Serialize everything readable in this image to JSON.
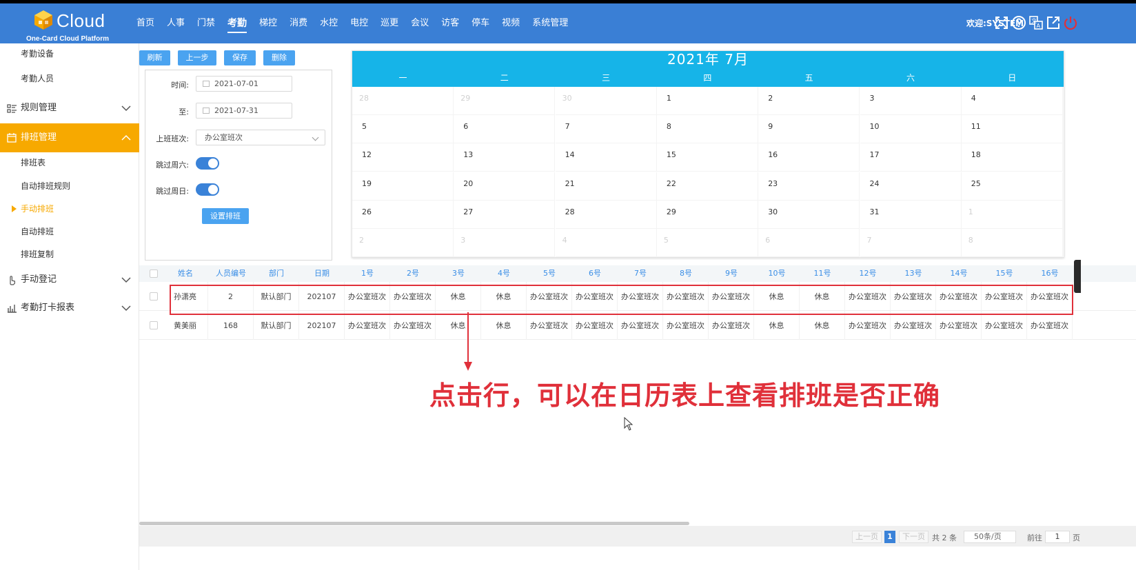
{
  "header": {
    "logo_word": "Cloud",
    "logo_sub": "One-Card Cloud Platform",
    "nav": [
      "首页",
      "人事",
      "门禁",
      "考勤",
      "梯控",
      "消费",
      "水控",
      "电控",
      "巡更",
      "会议",
      "访客",
      "停车",
      "视频",
      "系统管理"
    ],
    "active_nav": "考勤",
    "welcome": "欢迎:SYSTEM",
    "icons": [
      "fullscreen-icon",
      "help-icon",
      "translate-icon",
      "external-link-icon",
      "power-icon"
    ]
  },
  "sidebar": {
    "items": [
      {
        "label": "考勤设备",
        "type": "sub"
      },
      {
        "label": "考勤人员",
        "type": "sub"
      },
      {
        "label": "规则管理",
        "type": "group",
        "icon": "rules-list-icon"
      },
      {
        "label": "排班管理",
        "type": "group-active",
        "icon": "calendar-schedule-icon"
      },
      {
        "label": "排班表",
        "type": "sub"
      },
      {
        "label": "自动排班规则",
        "type": "sub"
      },
      {
        "label": "手动排班",
        "type": "current"
      },
      {
        "label": "自动排班",
        "type": "sub"
      },
      {
        "label": "排班复制",
        "type": "sub"
      },
      {
        "label": "手动登记",
        "type": "group",
        "icon": "hand-pointer-icon"
      },
      {
        "label": "考勤打卡报表",
        "type": "group",
        "icon": "bar-chart-icon"
      }
    ]
  },
  "toolbar": {
    "refresh": "刷新",
    "prev": "上一步",
    "save": "保存",
    "delete": "删除"
  },
  "form": {
    "time_label": "时间:",
    "time_value": "2021-07-01",
    "to_label": "至:",
    "to_value": "2021-07-31",
    "shift_label": "上班班次:",
    "shift_value": "办公室班次",
    "skip_sat_label": "跳过周六:",
    "skip_sat": true,
    "skip_sun_label": "跳过周日:",
    "skip_sun": true,
    "set_button": "设置排班"
  },
  "calendar": {
    "title": "2021年  7月",
    "weekdays": [
      "一",
      "二",
      "三",
      "四",
      "五",
      "六",
      "日"
    ],
    "weeks": [
      [
        {
          "d": "28",
          "o": true
        },
        {
          "d": "29",
          "o": true
        },
        {
          "d": "30",
          "o": true
        },
        {
          "d": "1"
        },
        {
          "d": "2"
        },
        {
          "d": "3"
        },
        {
          "d": "4"
        }
      ],
      [
        {
          "d": "5"
        },
        {
          "d": "6"
        },
        {
          "d": "7"
        },
        {
          "d": "8"
        },
        {
          "d": "9"
        },
        {
          "d": "10"
        },
        {
          "d": "11"
        }
      ],
      [
        {
          "d": "12"
        },
        {
          "d": "13"
        },
        {
          "d": "14"
        },
        {
          "d": "15"
        },
        {
          "d": "16"
        },
        {
          "d": "17"
        },
        {
          "d": "18"
        }
      ],
      [
        {
          "d": "19"
        },
        {
          "d": "20"
        },
        {
          "d": "21"
        },
        {
          "d": "22"
        },
        {
          "d": "23"
        },
        {
          "d": "24"
        },
        {
          "d": "25"
        }
      ],
      [
        {
          "d": "26"
        },
        {
          "d": "27"
        },
        {
          "d": "28"
        },
        {
          "d": "29"
        },
        {
          "d": "30"
        },
        {
          "d": "31"
        },
        {
          "d": "1",
          "o": true
        }
      ],
      [
        {
          "d": "2",
          "o": true
        },
        {
          "d": "3",
          "o": true
        },
        {
          "d": "4",
          "o": true
        },
        {
          "d": "5",
          "o": true
        },
        {
          "d": "6",
          "o": true
        },
        {
          "d": "7",
          "o": true
        },
        {
          "d": "8",
          "o": true
        }
      ]
    ]
  },
  "table": {
    "columns": [
      "姓名",
      "人员编号",
      "部门",
      "日期",
      "1号",
      "2号",
      "3号",
      "4号",
      "5号",
      "6号",
      "7号",
      "8号",
      "9号",
      "10号",
      "11号",
      "12号",
      "13号",
      "14号",
      "15号",
      "16号"
    ],
    "rows": [
      [
        "孙潇亮",
        "2",
        "默认部门",
        "202107",
        "办公室班次",
        "办公室班次",
        "休息",
        "休息",
        "办公室班次",
        "办公室班次",
        "办公室班次",
        "办公室班次",
        "办公室班次",
        "休息",
        "休息",
        "办公室班次",
        "办公室班次",
        "办公室班次",
        "办公室班次",
        "办公室班次"
      ],
      [
        "黄美丽",
        "168",
        "默认部门",
        "202107",
        "办公室班次",
        "办公室班次",
        "休息",
        "休息",
        "办公室班次",
        "办公室班次",
        "办公室班次",
        "办公室班次",
        "办公室班次",
        "休息",
        "休息",
        "办公室班次",
        "办公室班次",
        "办公室班次",
        "办公室班次",
        "办公室班次"
      ]
    ]
  },
  "annotation": "点击行，可以在日历表上查看排班是否正确",
  "pager": {
    "prev": "上一页",
    "current": "1",
    "next": "下一页",
    "total": "共 2 条",
    "page_size": "50条/页",
    "goto": "前往",
    "goto_value": "1",
    "page_unit": "页"
  },
  "colors": {
    "header": "#3a7fd5",
    "accent": "#f7a900",
    "calendar_head": "#16b4e8",
    "annotation": "#e0303a"
  }
}
